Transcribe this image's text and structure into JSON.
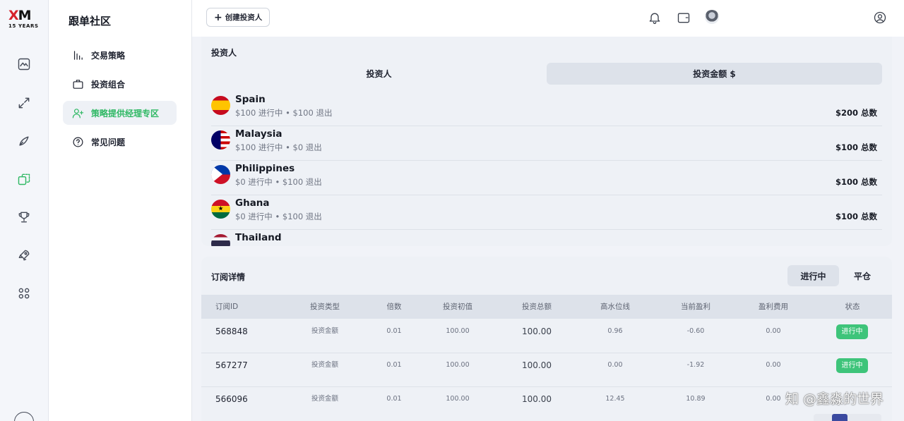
{
  "brand": {
    "mark": "XM",
    "years": "15 YEARS"
  },
  "sidebar": {
    "title": "跟单社区",
    "items": [
      {
        "label": "交易策略",
        "icon": "bar-chart-icon"
      },
      {
        "label": "投资组合",
        "icon": "briefcase-icon"
      },
      {
        "label": "策略提供经理专区",
        "icon": "user-plus-icon",
        "active": true
      },
      {
        "label": "常见问题",
        "icon": "help-circle-icon"
      }
    ]
  },
  "rail": [
    "chart-icon",
    "transfer-icon",
    "rocket-icon",
    "copy-icon",
    "trophy-icon",
    "launch-icon",
    "grid-icon"
  ],
  "topbar": {
    "create_label": "创建投资人"
  },
  "investors": {
    "title": "投资人",
    "segments": [
      "投资人",
      "投资金额 $"
    ],
    "rows": [
      {
        "country": "Spain",
        "detail": "$100 进行中 • $100 退出",
        "total": "$200 总数"
      },
      {
        "country": "Malaysia",
        "detail": "$100 进行中 • $0 退出",
        "total": "$100 总数"
      },
      {
        "country": "Philippines",
        "detail": "$0 进行中 • $100 退出",
        "total": "$100 总数"
      },
      {
        "country": "Ghana",
        "detail": "$0 进行中 • $100 退出",
        "total": "$100 总数"
      },
      {
        "country": "Thailand",
        "detail": "",
        "total": ""
      }
    ]
  },
  "subscriptions": {
    "title": "订阅详情",
    "tabs": [
      "进行中",
      "平仓"
    ],
    "columns": [
      "订阅ID",
      "投资类型",
      "倍数",
      "投资初值",
      "投资总额",
      "高水位线",
      "当前盈利",
      "盈利费用",
      "状态"
    ],
    "rows": [
      {
        "id": "568848",
        "type": "投资金额",
        "multiplier": "0.01",
        "initial": "100.00",
        "total": "100.00",
        "hwm": "0.96",
        "profit": "-0.60",
        "fee": "0.00",
        "status": "进行中"
      },
      {
        "id": "567277",
        "type": "投资金额",
        "multiplier": "0.01",
        "initial": "100.00",
        "total": "100.00",
        "hwm": "0.00",
        "profit": "-1.92",
        "fee": "0.00",
        "status": "进行中"
      },
      {
        "id": "566096",
        "type": "投资金额",
        "multiplier": "0.01",
        "initial": "100.00",
        "total": "100.00",
        "hwm": "12.45",
        "profit": "10.89",
        "fee": "0.00",
        "status": ""
      }
    ]
  },
  "watermark": "知 @鑫淼的世界",
  "colors": {
    "accent": "#2fb864",
    "badge": "#3ec47a",
    "pager": "#3b4aa0"
  }
}
